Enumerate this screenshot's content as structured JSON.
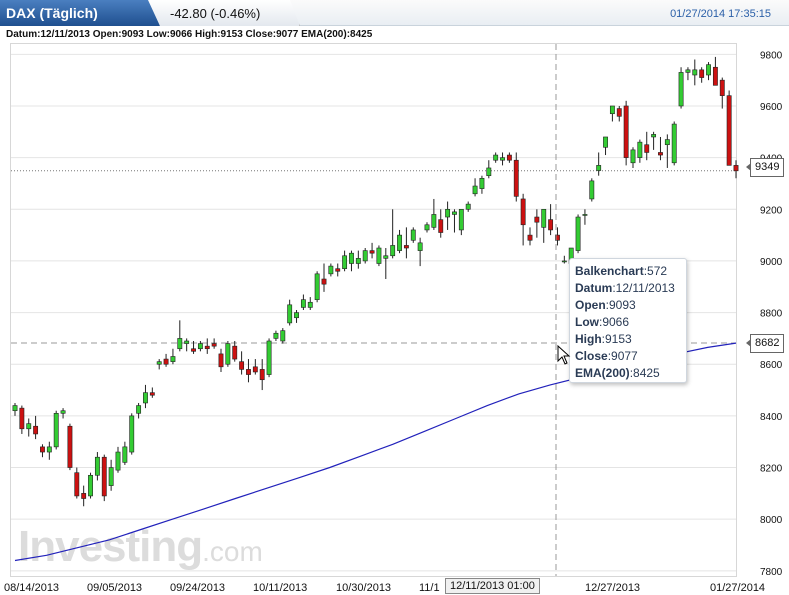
{
  "header": {
    "symbol": "DAX (Täglich)",
    "change": "-42.80 (-0.46%)",
    "timestamp": "01/27/2014 17:35:15"
  },
  "ohlc_line": "Datum:12/11/2013 Open:9093 Low:9066 High:9153 Close:9077 EMA(200):8425",
  "price_boxes": {
    "last": "9349",
    "ema": "8682"
  },
  "tooltip": [
    {
      "k": "Balkenchart",
      "v": ":572"
    },
    {
      "k": "Datum",
      "v": ":12/11/2013"
    },
    {
      "k": "Open",
      "v": ":9093"
    },
    {
      "k": "Low",
      "v": ":9066"
    },
    {
      "k": "High",
      "v": ":9153"
    },
    {
      "k": "Close",
      "v": ":9077"
    },
    {
      "k": "EMA(200)",
      "v": ":8425"
    }
  ],
  "cursor_label": "12/11/2013 01:00",
  "watermark": {
    "brand": "Investing",
    "suffix": ".com"
  },
  "colors": {
    "up": "#33cc33",
    "down": "#cc1111",
    "ema": "#2222bb",
    "grid": "#e4e4e4",
    "accent": "#2a5fa8"
  },
  "chart_data": {
    "type": "candlestick",
    "xlabels": [
      "08/14/2013",
      "09/05/2013",
      "09/24/2013",
      "10/11/2013",
      "10/30/2013",
      "11/1",
      "12/27/2013",
      "01/27/2014"
    ],
    "yticks": [
      7800,
      8000,
      8200,
      8400,
      8600,
      8800,
      9000,
      9200,
      9400,
      9600,
      9800
    ],
    "ylim": [
      7780,
      9840
    ],
    "last_close": 9349,
    "ema_marker": 8682,
    "candles": [
      [
        8420,
        8450,
        8400,
        8440
      ],
      [
        8430,
        8440,
        8330,
        8350
      ],
      [
        8350,
        8390,
        8320,
        8370
      ],
      [
        8360,
        8400,
        8310,
        8330
      ],
      [
        8280,
        8290,
        8240,
        8260
      ],
      [
        8260,
        8300,
        8230,
        8280
      ],
      [
        8280,
        8420,
        8270,
        8410
      ],
      [
        8410,
        8430,
        8390,
        8420
      ],
      [
        8360,
        8370,
        8190,
        8200
      ],
      [
        8180,
        8200,
        8080,
        8090
      ],
      [
        8100,
        8130,
        8050,
        8080
      ],
      [
        8090,
        8180,
        8080,
        8170
      ],
      [
        8170,
        8260,
        8150,
        8240
      ],
      [
        8240,
        8250,
        8070,
        8090
      ],
      [
        8130,
        8230,
        8110,
        8200
      ],
      [
        8190,
        8280,
        8180,
        8260
      ],
      [
        8220,
        8300,
        8210,
        8280
      ],
      [
        8260,
        8410,
        8250,
        8400
      ],
      [
        8410,
        8450,
        8390,
        8440
      ],
      [
        8450,
        8520,
        8430,
        8490
      ],
      [
        8490,
        8510,
        8470,
        8480
      ],
      [
        8600,
        8620,
        8580,
        8610
      ],
      [
        8620,
        8640,
        8590,
        8600
      ],
      [
        8610,
        8660,
        8600,
        8630
      ],
      [
        8660,
        8770,
        8650,
        8700
      ],
      [
        8680,
        8700,
        8650,
        8690
      ],
      [
        8660,
        8690,
        8640,
        8650
      ],
      [
        8660,
        8690,
        8650,
        8680
      ],
      [
        8670,
        8700,
        8640,
        8660
      ],
      [
        8680,
        8700,
        8660,
        8670
      ],
      [
        8640,
        8660,
        8570,
        8590
      ],
      [
        8600,
        8690,
        8590,
        8680
      ],
      [
        8670,
        8690,
        8610,
        8620
      ],
      [
        8610,
        8650,
        8560,
        8580
      ],
      [
        8580,
        8620,
        8530,
        8560
      ],
      [
        8590,
        8620,
        8560,
        8570
      ],
      [
        8580,
        8620,
        8500,
        8540
      ],
      [
        8560,
        8700,
        8550,
        8690
      ],
      [
        8700,
        8730,
        8690,
        8720
      ],
      [
        8690,
        8740,
        8680,
        8730
      ],
      [
        8760,
        8850,
        8750,
        8830
      ],
      [
        8780,
        8810,
        8760,
        8800
      ],
      [
        8820,
        8870,
        8810,
        8850
      ],
      [
        8820,
        8860,
        8810,
        8840
      ],
      [
        8850,
        8960,
        8840,
        8950
      ],
      [
        8930,
        8990,
        8880,
        8910
      ],
      [
        8950,
        8990,
        8940,
        8980
      ],
      [
        8970,
        8990,
        8940,
        8960
      ],
      [
        8970,
        9040,
        8960,
        9020
      ],
      [
        8990,
        9040,
        8960,
        9030
      ],
      [
        8990,
        9040,
        8970,
        9010
      ],
      [
        9000,
        9050,
        8990,
        9040
      ],
      [
        9040,
        9070,
        9010,
        9030
      ],
      [
        8990,
        9060,
        8980,
        9050
      ],
      [
        9010,
        9050,
        8930,
        9020
      ],
      [
        9020,
        9200,
        9010,
        9060
      ],
      [
        9040,
        9120,
        9030,
        9100
      ],
      [
        9060,
        9130,
        9010,
        9050
      ],
      [
        9080,
        9130,
        9070,
        9120
      ],
      [
        9040,
        9090,
        8980,
        9070
      ],
      [
        9120,
        9150,
        9110,
        9140
      ],
      [
        9130,
        9240,
        9120,
        9180
      ],
      [
        9160,
        9200,
        9090,
        9110
      ],
      [
        9170,
        9230,
        9120,
        9200
      ],
      [
        9180,
        9200,
        9110,
        9190
      ],
      [
        9120,
        9200,
        9100,
        9200
      ],
      [
        9200,
        9230,
        9190,
        9220
      ],
      [
        9260,
        9320,
        9250,
        9290
      ],
      [
        9280,
        9330,
        9260,
        9320
      ],
      [
        9330,
        9390,
        9320,
        9360
      ],
      [
        9390,
        9420,
        9380,
        9410
      ],
      [
        9390,
        9420,
        9370,
        9400
      ],
      [
        9410,
        9420,
        9380,
        9390
      ],
      [
        9390,
        9420,
        9230,
        9250
      ],
      [
        9240,
        9260,
        9060,
        9140
      ],
      [
        9100,
        9130,
        9060,
        9080
      ],
      [
        9170,
        9200,
        9090,
        9150
      ],
      [
        9130,
        9200,
        9070,
        9200
      ],
      [
        9160,
        9220,
        9100,
        9120
      ],
      [
        9100,
        9130,
        9060,
        9080
      ],
      [
        9000,
        9020,
        8990,
        9000
      ],
      [
        8990,
        9040,
        8960,
        9050
      ],
      [
        9040,
        9180,
        9030,
        9170
      ],
      [
        9180,
        9200,
        9140,
        9180
      ],
      [
        9240,
        9320,
        9230,
        9310
      ],
      [
        9350,
        9420,
        9330,
        9370
      ],
      [
        9440,
        9480,
        9410,
        9480
      ],
      [
        9570,
        9600,
        9540,
        9600
      ],
      [
        9590,
        9600,
        9540,
        9560
      ],
      [
        9600,
        9620,
        9370,
        9400
      ],
      [
        9380,
        9440,
        9360,
        9430
      ],
      [
        9400,
        9470,
        9380,
        9460
      ],
      [
        9450,
        9500,
        9390,
        9420
      ],
      [
        9480,
        9500,
        9430,
        9490
      ],
      [
        9420,
        9480,
        9390,
        9410
      ],
      [
        9450,
        9490,
        9360,
        9470
      ],
      [
        9380,
        9540,
        9370,
        9530
      ],
      [
        9600,
        9750,
        9590,
        9730
      ],
      [
        9730,
        9750,
        9700,
        9740
      ],
      [
        9720,
        9780,
        9680,
        9740
      ],
      [
        9740,
        9750,
        9690,
        9710
      ],
      [
        9720,
        9770,
        9700,
        9760
      ],
      [
        9750,
        9790,
        9720,
        9680
      ],
      [
        9700,
        9710,
        9590,
        9640
      ],
      [
        9640,
        9660,
        9370,
        9370
      ],
      [
        9370,
        9390,
        9320,
        9349
      ]
    ],
    "ema200": [
      [
        0,
        7840
      ],
      [
        20,
        7860
      ],
      [
        40,
        7890
      ],
      [
        60,
        7920
      ],
      [
        80,
        7960
      ],
      [
        100,
        8000
      ],
      [
        120,
        8040
      ],
      [
        140,
        8080
      ],
      [
        160,
        8120
      ],
      [
        180,
        8160
      ],
      [
        200,
        8200
      ],
      [
        220,
        8245
      ],
      [
        240,
        8290
      ],
      [
        260,
        8340
      ],
      [
        280,
        8390
      ],
      [
        300,
        8440
      ],
      [
        320,
        8485
      ],
      [
        340,
        8520
      ],
      [
        360,
        8550
      ],
      [
        380,
        8580
      ],
      [
        400,
        8610
      ],
      [
        420,
        8640
      ],
      [
        440,
        8665
      ],
      [
        458,
        8682
      ]
    ]
  }
}
